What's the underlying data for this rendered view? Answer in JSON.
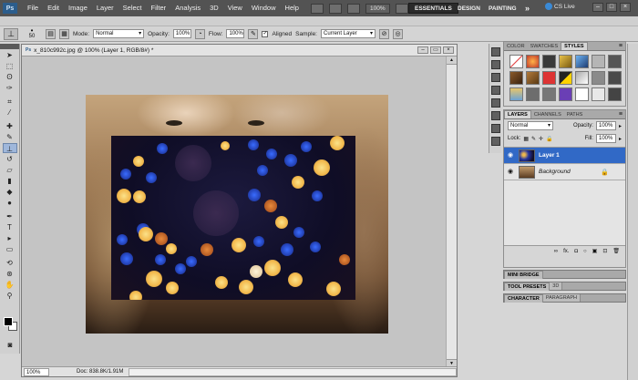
{
  "app": {
    "logo": "Ps"
  },
  "menu": [
    "File",
    "Edit",
    "Image",
    "Layer",
    "Select",
    "Filter",
    "Analysis",
    "3D",
    "View",
    "Window",
    "Help"
  ],
  "appbar": {
    "zoom": "100%"
  },
  "workspace": {
    "essentials": "ESSENTIALS",
    "design": "DESIGN",
    "painting": "PAINTING",
    "more": "»",
    "cs_live": "CS Live"
  },
  "options": {
    "brush_size": "50",
    "mode_label": "Mode:",
    "mode_value": "Normal",
    "opacity_label": "Opacity:",
    "opacity_value": "100%",
    "flow_label": "Flow:",
    "flow_value": "100%",
    "aligned_label": "Aligned",
    "sample_label": "Sample:",
    "sample_value": "Current Layer"
  },
  "document": {
    "title": "x_810c992c.jpg @ 100% (Layer 1, RGB/8#) *",
    "zoom": "100%",
    "info": "Doc: 838.8K/1.91M"
  },
  "panels": {
    "swatches_tabs": [
      "COLOR",
      "SWATCHES",
      "STYLES"
    ],
    "layers_tabs": [
      "LAYERS",
      "CHANNELS",
      "PATHS"
    ],
    "blend_mode": "Normal",
    "opacity_label": "Opacity:",
    "opacity_value": "100%",
    "lock_label": "Lock:",
    "fill_label": "Fill:",
    "fill_value": "100%",
    "layers": [
      {
        "name": "Layer 1",
        "selected": true
      },
      {
        "name": "Background",
        "selected": false
      }
    ],
    "layer_footer": [
      "∞",
      "fx.",
      "◘",
      "○",
      "▣",
      "⊡",
      "🗑"
    ],
    "mini_bridge": "MINI BRIDGE",
    "tool_presets_tabs": [
      "TOOL PRESETS",
      "3D"
    ],
    "character_tabs": [
      "CHARACTER",
      "PARAGRAPH"
    ]
  },
  "colors": {
    "accent": "#3169c6",
    "chrome": "#535353"
  }
}
